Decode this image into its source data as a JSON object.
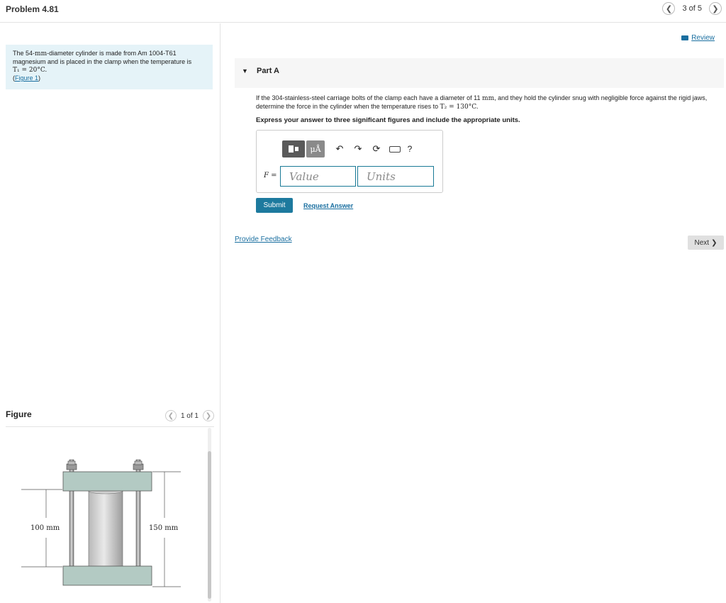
{
  "header": {
    "title": "Problem 4.81",
    "page_indicator": "3 of 5",
    "prev_icon": "chevron-left-icon",
    "next_icon": "chevron-right-icon"
  },
  "review": {
    "label": "Review",
    "icon": "book-icon"
  },
  "intro": {
    "line1": "The 54-",
    "mm": "mm",
    "line1b": "-diameter cylinder is made from Am 1004-T61 magnesium and is placed in the clamp when the temperature is",
    "t1": "T₁ = 20°C.",
    "figure_link": "Figure 1"
  },
  "figure": {
    "label": "Figure",
    "page_indicator": "1 of 1",
    "dim_left": "100 mm",
    "dim_right": "150 mm"
  },
  "part": {
    "label": "Part A",
    "question_a": "If the 304-stainless-steel carriage bolts of the clamp each have a diameter of 11",
    "mm": "mm",
    "question_b": ", and they hold the cylinder snug with negligible force against the rigid jaws, determine the force in the cylinder when the temperature rises to",
    "t2": "T₂ = 130°C.",
    "instruction": "Express your answer to three significant figures and include the appropriate units."
  },
  "answer": {
    "variable": "F",
    "equals": " =",
    "value_placeholder": "Value",
    "units_placeholder": "Units",
    "mu_label": "μÅ",
    "help_label": "?"
  },
  "actions": {
    "submit_label": "Submit",
    "request_label": "Request Answer",
    "feedback_label": "Provide Feedback",
    "next_label": "Next"
  }
}
